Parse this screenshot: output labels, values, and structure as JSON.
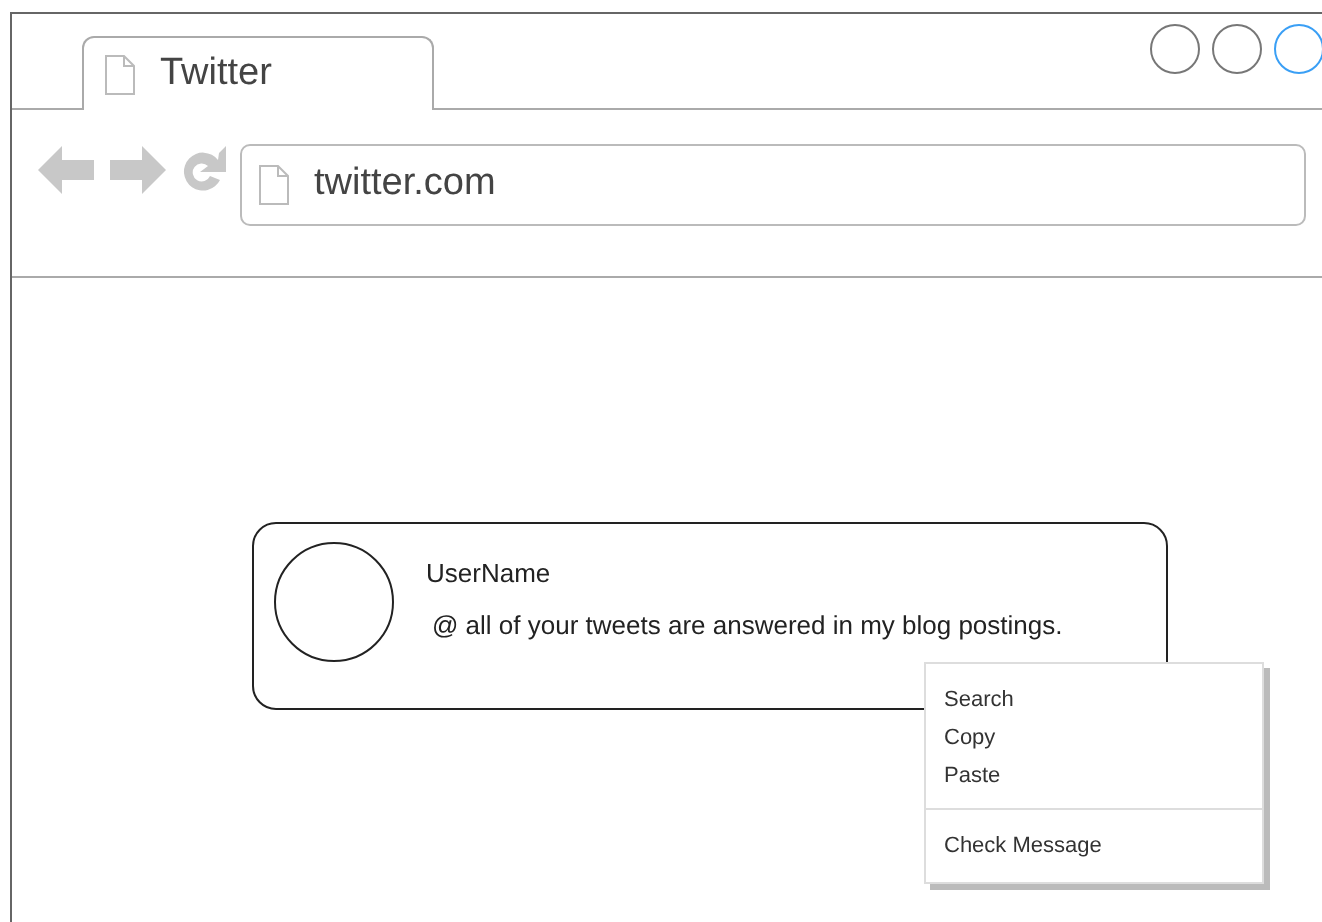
{
  "tab": {
    "title": "Twitter"
  },
  "window_controls": [
    {
      "highlighted": false
    },
    {
      "highlighted": false
    },
    {
      "highlighted": true
    }
  ],
  "address_bar": {
    "url": "twitter.com"
  },
  "tweet": {
    "username": "UserName",
    "message": "@ all of your tweets are answered in my blog postings."
  },
  "context_menu": {
    "groups": [
      {
        "items": [
          "Search",
          "Copy",
          "Paste"
        ]
      },
      {
        "items": [
          "Check Message"
        ]
      }
    ]
  }
}
